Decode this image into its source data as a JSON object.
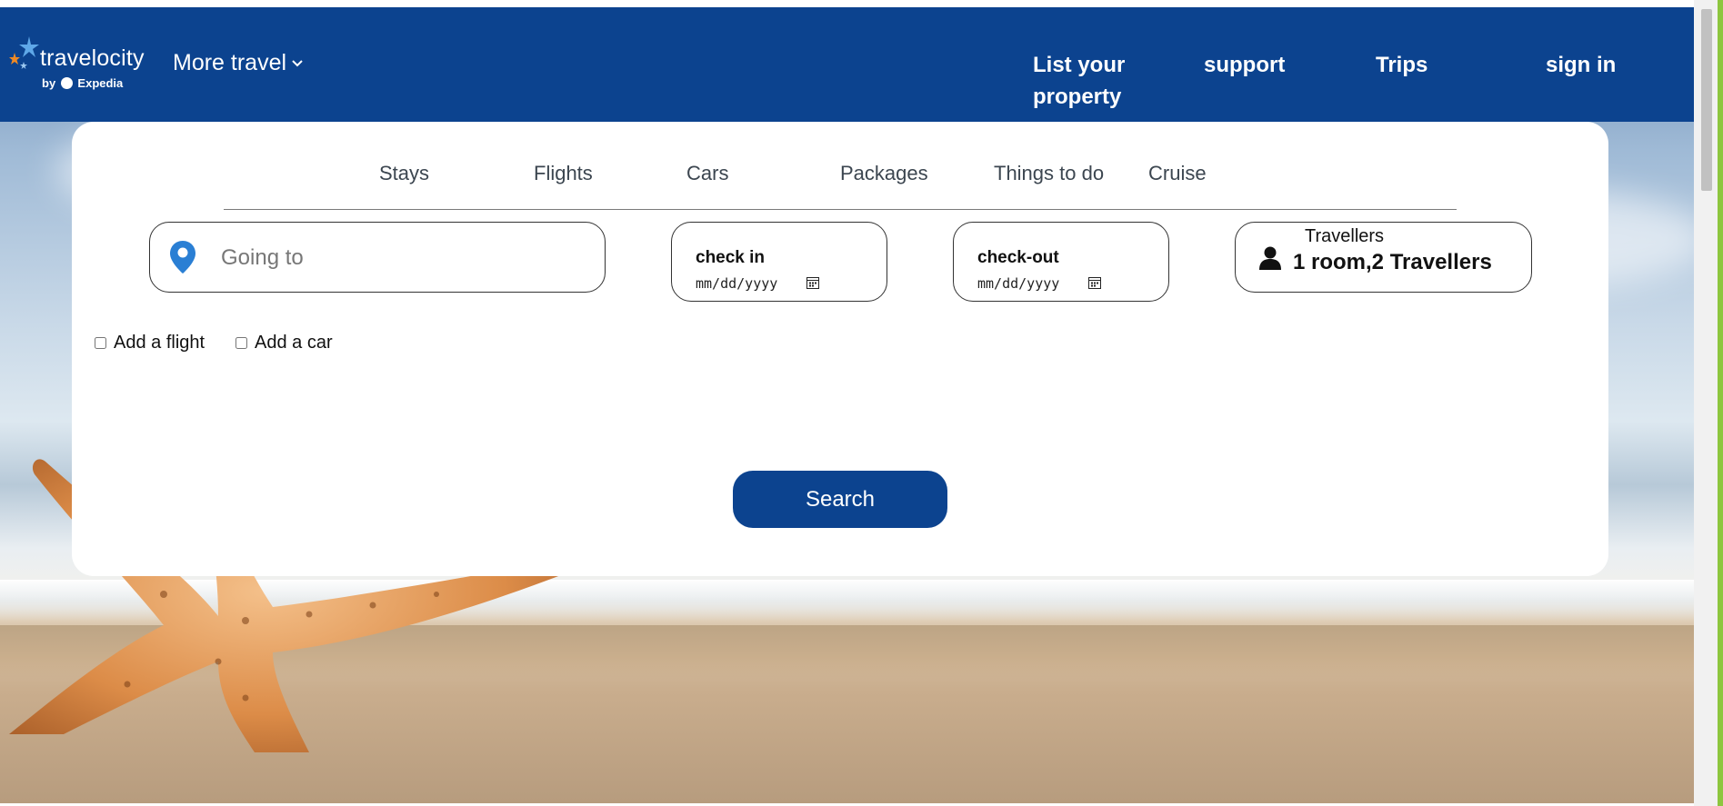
{
  "colors": {
    "brand_blue": "#0c438f",
    "pin_blue": "#2a7fd4",
    "logo_orange": "#f08a24",
    "scroll_accent": "#8dc63f"
  },
  "header": {
    "logo": {
      "wordmark": "travelocity",
      "byline": "by",
      "partner": "Expedia"
    },
    "more_travel": "More travel",
    "links": {
      "list_property": "List your property",
      "support": "support",
      "trips": "Trips",
      "sign_in": "sign in"
    }
  },
  "search": {
    "tabs": [
      "Stays",
      "Flights",
      "Cars",
      "Packages",
      "Things to do",
      "Cruise"
    ],
    "destination": {
      "placeholder": "Going to",
      "value": ""
    },
    "check_in": {
      "label": "check in",
      "value": "mm/dd/yyyy"
    },
    "check_out": {
      "label": "check-out",
      "value": "mm/dd/yyyy"
    },
    "travellers": {
      "label": "Travellers",
      "value": "1 room,2 Travellers"
    },
    "options": {
      "add_flight": {
        "label": "Add a flight",
        "checked": false
      },
      "add_car": {
        "label": "Add a car",
        "checked": false
      }
    },
    "submit_label": "Search"
  },
  "icons": [
    "logo-stars-icon",
    "chevron-down-icon",
    "location-pin-icon",
    "calendar-icon",
    "person-icon"
  ]
}
